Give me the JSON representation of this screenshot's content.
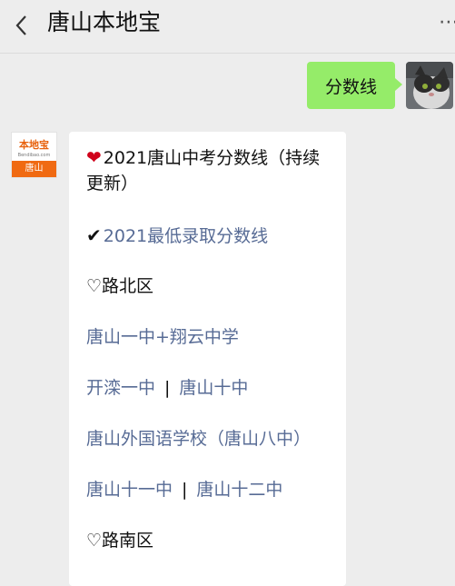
{
  "header": {
    "title": "唐山本地宝"
  },
  "conversation": {
    "user_message": "分数线",
    "bot_avatar": {
      "logo_text": "本地宝",
      "logo_sub": "Bendibao.com",
      "city": "唐山"
    },
    "reply": {
      "title": "2021唐山中考分数线（持续更新）",
      "subtitle_link": "2021最低录取分数线",
      "section_north": "♡路北区",
      "link_row1": "唐山一中+翔云中学",
      "link_row2_a": "开滦一中",
      "link_row2_b": "唐山十中",
      "link_row3": "唐山外国语学校（唐山八中）",
      "link_row4_a": "唐山十一中",
      "link_row4_b": "唐山十二中",
      "section_south": "♡路南区",
      "separator": "|"
    }
  }
}
